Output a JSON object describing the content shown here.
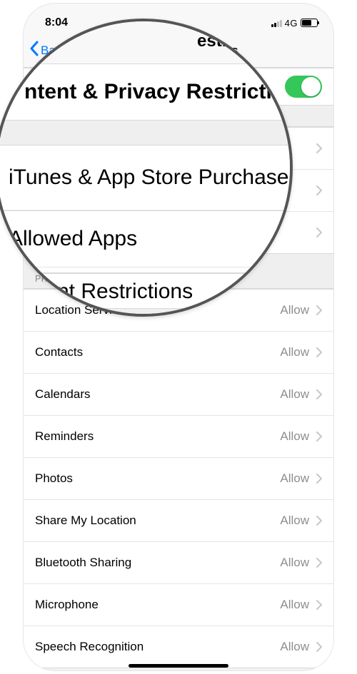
{
  "status": {
    "time": "8:04",
    "network": "4G"
  },
  "nav": {
    "back_label": "Back",
    "title": "Content Restrictions"
  },
  "toggle": {
    "label": "Content & Privacy Restrictions",
    "on": true
  },
  "main_items": [
    {
      "label": "iTunes & App Store Purchases"
    },
    {
      "label": "Allowed Apps"
    },
    {
      "label": "Content Restrictions"
    }
  ],
  "privacy_header": "Privacy",
  "privacy_items": [
    {
      "label": "Location Services",
      "value": "Allow"
    },
    {
      "label": "Contacts",
      "value": "Allow"
    },
    {
      "label": "Calendars",
      "value": "Allow"
    },
    {
      "label": "Reminders",
      "value": "Allow"
    },
    {
      "label": "Photos",
      "value": "Allow"
    },
    {
      "label": "Share My Location",
      "value": "Allow"
    },
    {
      "label": "Bluetooth Sharing",
      "value": "Allow"
    },
    {
      "label": "Microphone",
      "value": "Allow"
    },
    {
      "label": "Speech Recognition",
      "value": "Allow"
    }
  ],
  "magnifier": {
    "nav_title_frag": "estrictions",
    "back_letter": "B",
    "header": "ntent & Privacy Restricti",
    "item_itunes": "iTunes & App Store Purchases",
    "item_allowed": "Allowed Apps",
    "content_rest_frag": "nt Restrictions",
    "privacy_frag": "PRIVA"
  },
  "colors": {
    "accent_blue": "#007aff",
    "toggle_green": "#34c759",
    "secondary_text": "#8e8e93"
  }
}
